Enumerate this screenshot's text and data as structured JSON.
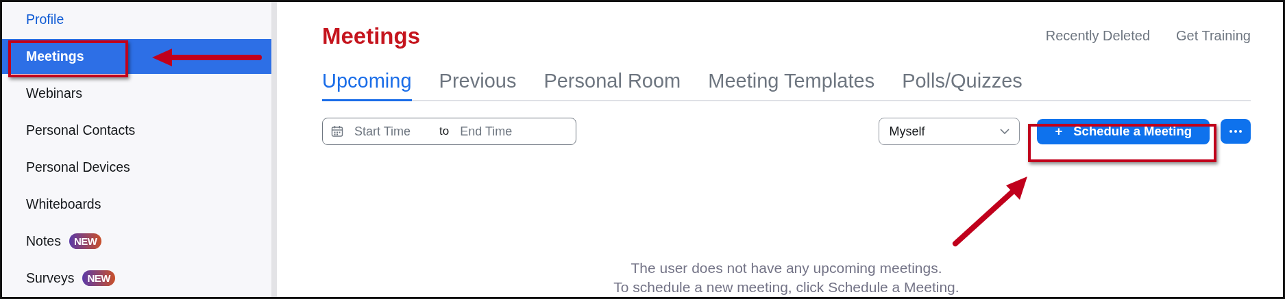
{
  "sidebar": {
    "items": [
      {
        "label": "Profile",
        "kind": "link",
        "selected": false
      },
      {
        "label": "Meetings",
        "kind": "item",
        "selected": true
      },
      {
        "label": "Webinars",
        "kind": "item",
        "selected": false
      },
      {
        "label": "Personal Contacts",
        "kind": "item",
        "selected": false
      },
      {
        "label": "Personal Devices",
        "kind": "item",
        "selected": false
      },
      {
        "label": "Whiteboards",
        "kind": "item",
        "selected": false
      },
      {
        "label": "Notes",
        "kind": "item",
        "selected": false,
        "badge": "NEW"
      },
      {
        "label": "Surveys",
        "kind": "item",
        "selected": false,
        "badge": "NEW"
      }
    ]
  },
  "main": {
    "title": "Meetings",
    "links": [
      "Recently Deleted",
      "Get Training"
    ],
    "tabs": [
      {
        "label": "Upcoming",
        "selected": true
      },
      {
        "label": "Previous",
        "selected": false
      },
      {
        "label": "Personal Room",
        "selected": false
      },
      {
        "label": "Meeting Templates",
        "selected": false
      },
      {
        "label": "Polls/Quizzes",
        "selected": false
      }
    ],
    "date_range": {
      "start_placeholder": "Start Time",
      "separator": "to",
      "end_placeholder": "End Time"
    },
    "host_select": {
      "value": "Myself"
    },
    "schedule_button": {
      "icon": "+",
      "label": "Schedule a Meeting"
    },
    "empty_message": [
      "The user does not have any upcoming meetings.",
      "To schedule a new meeting, click Schedule a Meeting."
    ]
  }
}
